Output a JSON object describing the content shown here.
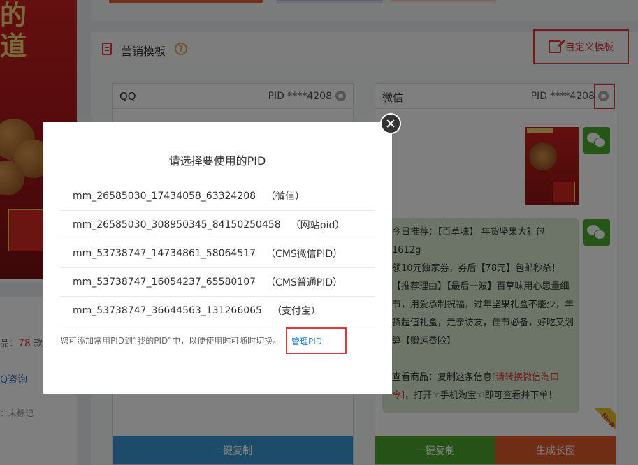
{
  "left": {
    "count_label": "品：",
    "count_value": "78",
    "count_unit": " 款",
    "qq_link": "Q咨询",
    "mark_text": "：未标记",
    "product_text": "的道"
  },
  "panel": {
    "title": "营销模板",
    "help": "?",
    "custom_template": "自定义模板"
  },
  "cards": {
    "qq": {
      "name": "QQ",
      "pid": "PID ****4208",
      "copy": "一键复制"
    },
    "wechat": {
      "name": "微信",
      "pid": "PID ****4208",
      "copy": "一键复制",
      "long_image": "生成长图",
      "new_badge": "New",
      "message": {
        "line1": "今日推荐：【百草味】 年货坚果大礼包",
        "line2": "1612g",
        "line3": "领10元独家券，券后【78元】包邮秒杀！",
        "line4": "【推荐理由】【最后一波】百草味用心思量细节，用爱承制祝福，过年坚果礼盒不能少，年货超值礼盒，走亲访友，佳节必备，好吃又划算【赠运费险】",
        "line5_prefix": "查看商品：复制这条信息",
        "line5_red": "[请转换微信淘口令]",
        "line5_suffix": "，打开☞手机淘宝☜即可查看并下单！"
      }
    }
  },
  "modal": {
    "title": "请选择要使用的PID",
    "options": [
      {
        "pid": "mm_26585030_17434058_63324208",
        "tag": "（微信）"
      },
      {
        "pid": "mm_26585030_308950345_84150250458",
        "tag": "（网站pid）"
      },
      {
        "pid": "mm_53738747_14734861_58064517",
        "tag": "（CMS微信PID）"
      },
      {
        "pid": "mm_53738747_16054237_65580107",
        "tag": "（CMS普通PID）"
      },
      {
        "pid": "mm_53738747_36644563_131266065",
        "tag": "（支付宝）"
      }
    ],
    "tip": "您可添加常用PID到“我的PID”中，以便使用时可随时切换。",
    "manage": "管理PID"
  },
  "colors": {
    "accent_red": "#e4393c",
    "copy_blue": "#3a97d4",
    "copy_green": "#4aa52e",
    "long_image_orange": "#e05a2b"
  }
}
